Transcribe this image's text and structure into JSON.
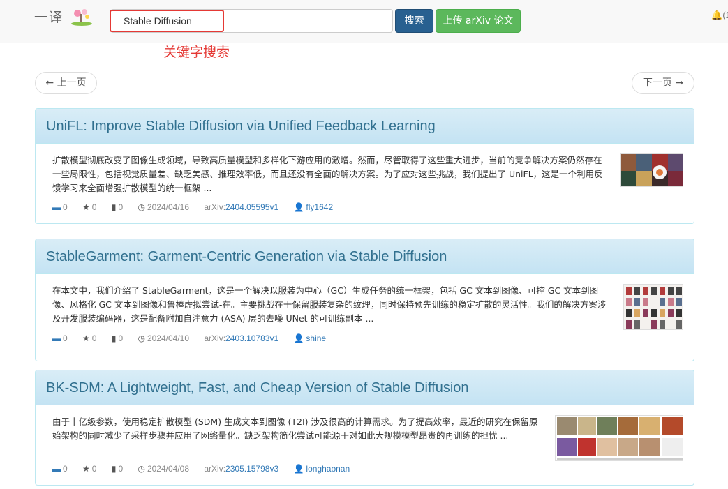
{
  "header": {
    "brand": "一译",
    "search_value": "Stable Diffusion",
    "search_button": "搜索",
    "upload_button": "上传 arXiv 论文",
    "bell_label": "(1"
  },
  "annotation": "关键字搜索",
  "pager": {
    "prev": "← 上一页",
    "next": "下一页 →"
  },
  "papers": [
    {
      "title": "UniFL: Improve Stable Diffusion via Unified Feedback Learning",
      "abstract": "扩散模型彻底改变了图像生成领域，导致高质量模型和多样化下游应用的激增。然而，尽管取得了这些重大进步，当前的竞争解决方案仍然存在一些局限性，包括视觉质量差、缺乏美感、推理效率低，而且还没有全面的解决方案。为了应对这些挑战，我们提出了 UniFL，这是一个利用反馈学习来全面增强扩散模型的统一框架 ...",
      "comments": "0",
      "stars": "0",
      "views": "0",
      "date": "2024/04/16",
      "arxiv_prefix": "arXiv:",
      "arxiv_id": "2404.05595v1",
      "user": "fly1642"
    },
    {
      "title": "StableGarment: Garment-Centric Generation via Stable Diffusion",
      "abstract": "在本文中，我们介绍了 StableGarment，这是一个解决以服装为中心（GC）生成任务的统一框架，包括 GC 文本到图像、可控 GC 文本到图像、风格化 GC 文本到图像和鲁棒虚拟尝试-在。主要挑战在于保留服装复杂的纹理，同时保持预先训练的稳定扩散的灵活性。我们的解决方案涉及开发服装编码器，这是配备附加自注意力 (ASA) 层的去噪 UNet 的可训练副本 ...",
      "comments": "0",
      "stars": "0",
      "views": "0",
      "date": "2024/04/10",
      "arxiv_prefix": "arXiv:",
      "arxiv_id": "2403.10783v1",
      "user": "shine"
    },
    {
      "title": "BK-SDM: A Lightweight, Fast, and Cheap Version of Stable Diffusion",
      "abstract": "由于十亿级参数，使用稳定扩散模型 (SDM) 生成文本到图像 (T2I) 涉及很高的计算需求。为了提高效率，最近的研究在保留原始架构的同时减少了采样步骤并应用了网络量化。缺乏架构简化尝试可能源于对如此大规模模型昂贵的再训练的担忧 ...",
      "comments": "0",
      "stars": "0",
      "views": "0",
      "date": "2024/04/08",
      "arxiv_prefix": "arXiv:",
      "arxiv_id": "2305.15798v3",
      "user": "longhaonan"
    }
  ],
  "icons": {
    "comment": "comment-icon",
    "star": "star-icon",
    "views": "bar-chart-icon",
    "clock": "clock-icon",
    "user": "user-icon",
    "bell": "bell-icon"
  },
  "colors": {
    "primary": "#286090",
    "success": "#5cb85c",
    "link": "#337ab7",
    "annotation": "#e53935"
  }
}
